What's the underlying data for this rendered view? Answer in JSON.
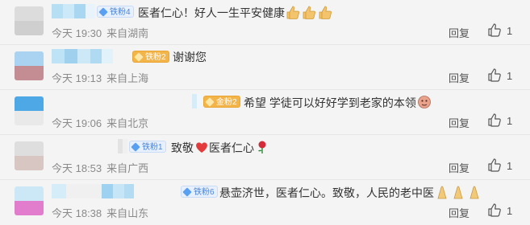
{
  "comments": [
    {
      "badge": "铁粉4",
      "text": "医者仁心！好人一生平安健康",
      "emoji_icon": "thumbs-up-emoji",
      "time": "今天 19:30",
      "location": "来自湖南",
      "reply_label": "回复",
      "likes": "1",
      "avatar_colors": [
        "#d9d9d9",
        "#c9c9c9"
      ]
    },
    {
      "badge": "铁粉2",
      "text": "谢谢您",
      "time": "今天 19:13",
      "location": "来自上海",
      "reply_label": "回复",
      "likes": "1",
      "avatar_colors": [
        "#a8d2f0",
        "#c68f95"
      ]
    },
    {
      "badge": "金粉2",
      "text": "希望 学徒可以好好学到老家的本领",
      "emoji_icon": "face-emoji",
      "time": "今天 19:06",
      "location": "来自北京",
      "reply_label": "回复",
      "likes": "1",
      "avatar_colors": [
        "#4ea8e6",
        "#e9e9e9"
      ]
    },
    {
      "badge": "铁粉1",
      "text": "致敬",
      "text_after": "医者仁心",
      "emoji_icon": "heart-emoji",
      "emoji_icon_2": "rose-emoji",
      "time": "今天 18:53",
      "location": "来自广西",
      "reply_label": "回复",
      "likes": "1",
      "avatar_colors": [
        "#dcdcdc",
        "#d7c5c2"
      ]
    },
    {
      "badge": "铁粉6",
      "text": "悬壶济世，医者仁心。致敬，人民的老中医",
      "emoji_icon": "folded-hands-emoji",
      "time": "今天 18:38",
      "location": "来自山东",
      "reply_label": "回复",
      "likes": "1",
      "avatar_colors": [
        "#c9e7f7",
        "#e57ecf"
      ]
    }
  ]
}
